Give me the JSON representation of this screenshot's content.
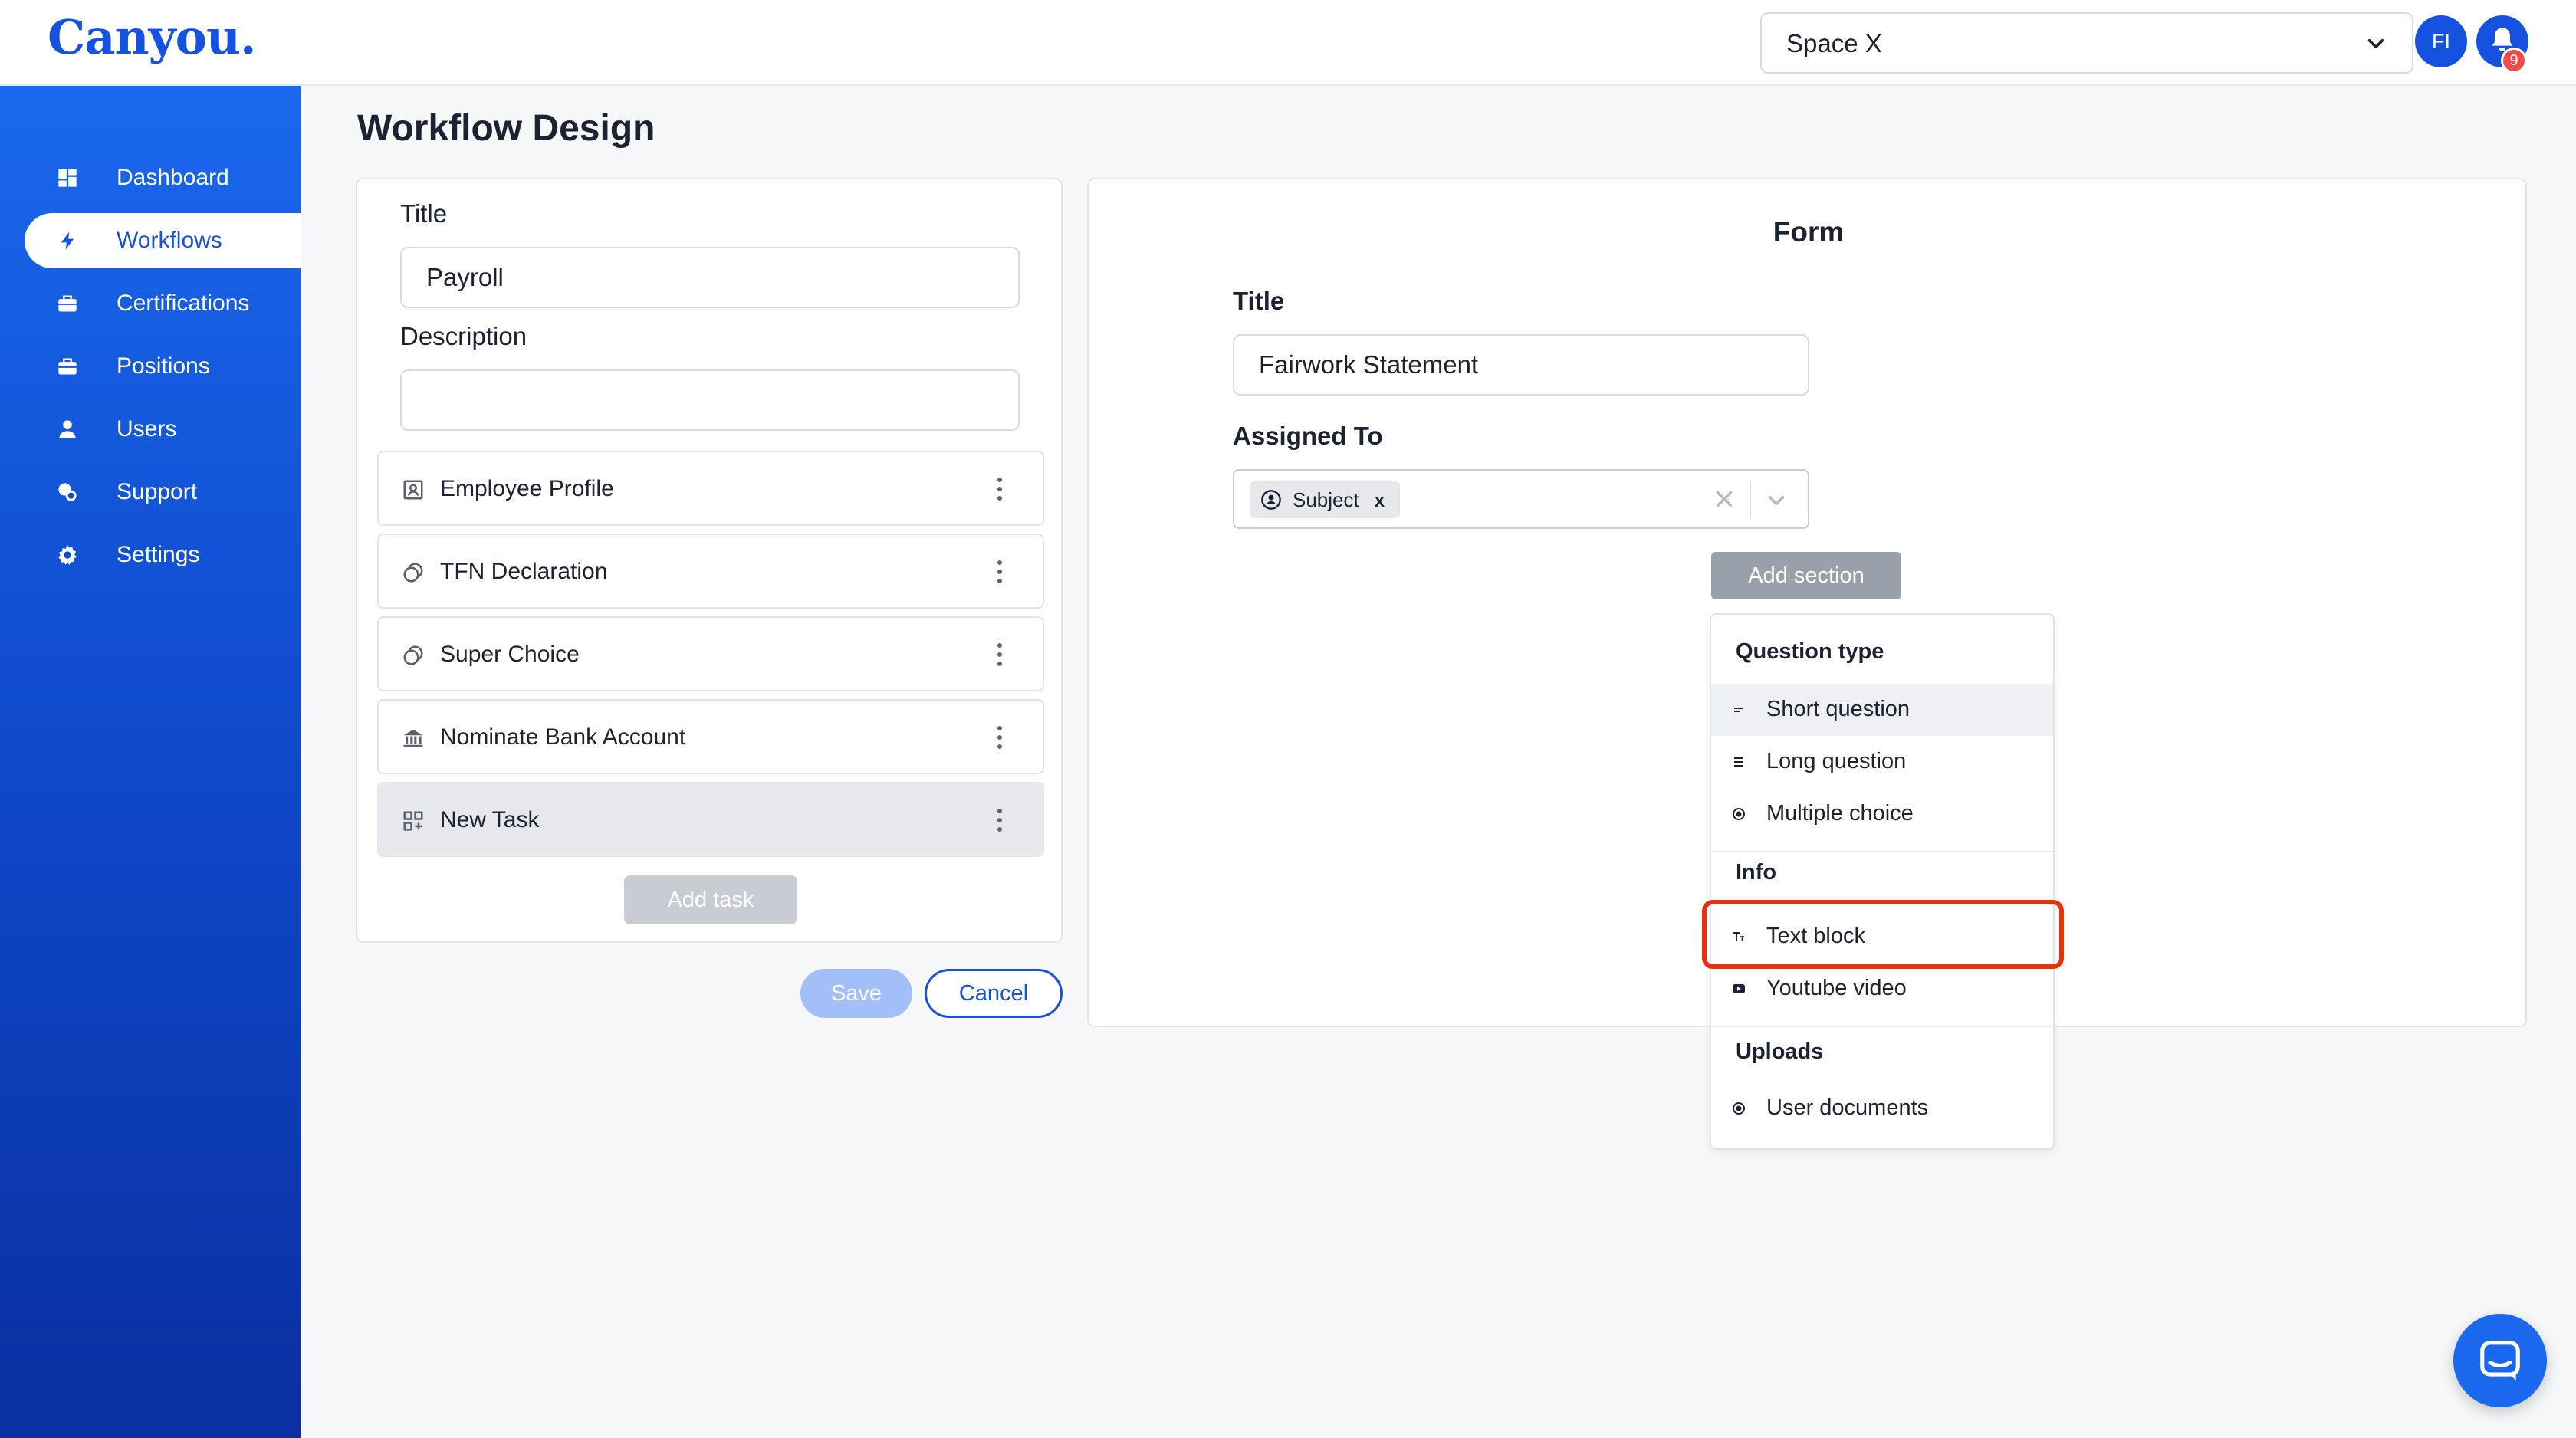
{
  "app": {
    "logo": "Canyou."
  },
  "header": {
    "space_selector": {
      "value": "Space X"
    },
    "avatar_initials": "FI",
    "notification_count": "9"
  },
  "sidebar": {
    "items": [
      {
        "label": "Dashboard",
        "icon": "dashboard-icon",
        "active": false
      },
      {
        "label": "Workflows",
        "icon": "bolt-icon",
        "active": true
      },
      {
        "label": "Certifications",
        "icon": "briefcase-icon",
        "active": false
      },
      {
        "label": "Positions",
        "icon": "briefcase-icon",
        "active": false
      },
      {
        "label": "Users",
        "icon": "user-icon",
        "active": false
      },
      {
        "label": "Support",
        "icon": "support-icon",
        "active": false
      },
      {
        "label": "Settings",
        "icon": "gear-icon",
        "active": false
      }
    ]
  },
  "page": {
    "title": "Workflow Design"
  },
  "workflow": {
    "title_label": "Title",
    "title_value": "Payroll",
    "description_label": "Description",
    "description_value": "",
    "tasks": [
      {
        "label": "Employee Profile",
        "icon": "profile-icon"
      },
      {
        "label": "TFN Declaration",
        "icon": "coins-icon"
      },
      {
        "label": "Super Choice",
        "icon": "coins-icon"
      },
      {
        "label": "Nominate Bank Account",
        "icon": "bank-icon"
      },
      {
        "label": "New Task",
        "icon": "grid-add-icon",
        "selected": true
      }
    ],
    "add_task_label": "Add task",
    "save_label": "Save",
    "cancel_label": "Cancel"
  },
  "form": {
    "heading": "Form",
    "title_label": "Title",
    "title_value": "Fairwork Statement",
    "assigned_label": "Assigned To",
    "assigned_chip": "Subject",
    "chip_remove": "x",
    "add_section_label": "Add section"
  },
  "menu": {
    "groups": [
      {
        "label": "Question type",
        "items": [
          {
            "label": "Short question",
            "icon": "short-text-icon"
          },
          {
            "label": "Long question",
            "icon": "long-text-icon"
          },
          {
            "label": "Multiple choice",
            "icon": "radio-icon"
          }
        ]
      },
      {
        "label": "Info",
        "items": [
          {
            "label": "Text block",
            "icon": "text-block-icon"
          },
          {
            "label": "Youtube video",
            "icon": "youtube-icon"
          }
        ]
      },
      {
        "label": "Uploads",
        "items": [
          {
            "label": "User documents",
            "icon": "radio-icon"
          }
        ]
      }
    ]
  },
  "colors": {
    "brand": "#1652e0",
    "sidebar_top": "#1a68ee",
    "sidebar_bottom": "#0a2fa0",
    "highlight": "#e8320f",
    "notification_badge": "#ef4b4b"
  }
}
